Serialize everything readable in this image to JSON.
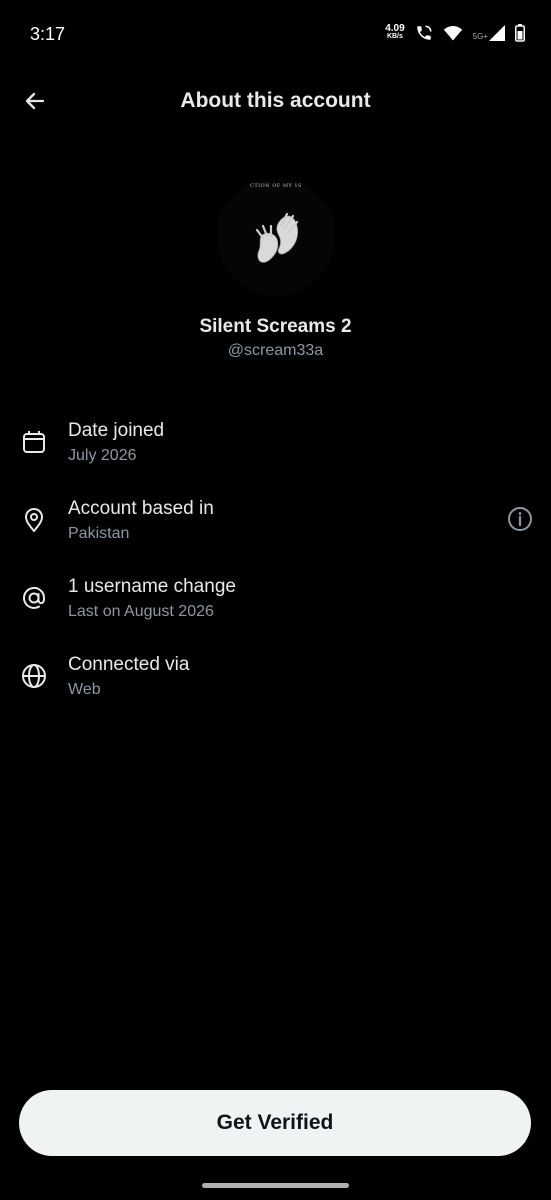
{
  "status_bar": {
    "time": "3:17",
    "net_speed_value": "4.09",
    "net_speed_unit": "KB/s",
    "network_type": "5G+",
    "icons": [
      "call-wifi-icon",
      "wifi-icon",
      "signal-icon",
      "battery-icon"
    ]
  },
  "header": {
    "title": "About this account",
    "back_icon": "arrow-left-icon"
  },
  "profile": {
    "avatar_caption": "CTION OF MY 1S",
    "display_name": "Silent Screams 2",
    "handle": "@scream33a"
  },
  "info_rows": [
    {
      "icon": "calendar-icon",
      "title": "Date joined",
      "subtitle": "July 2026"
    },
    {
      "icon": "location-pin-icon",
      "title": "Account based in",
      "subtitle": "Pakistan",
      "trailing_icon": "info-icon"
    },
    {
      "icon": "at-sign-icon",
      "title": "1 username change",
      "subtitle": "Last on August 2026"
    },
    {
      "icon": "globe-icon",
      "title": "Connected via",
      "subtitle": "Web"
    }
  ],
  "footer": {
    "verify_label": "Get Verified"
  },
  "colors": {
    "background": "#000000",
    "primary_text": "#e7e9ea",
    "secondary_text": "#8b98a5",
    "button_bg": "#eff3f4",
    "button_text": "#0f1419"
  }
}
